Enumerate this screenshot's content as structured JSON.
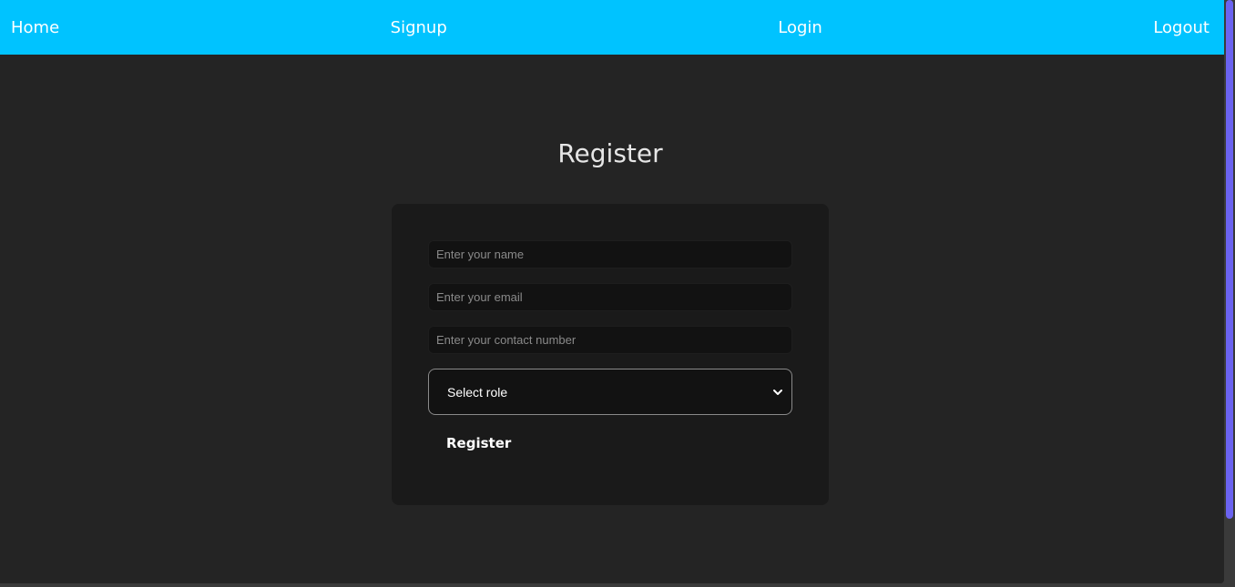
{
  "navbar": {
    "items": [
      {
        "label": "Home"
      },
      {
        "label": "Signup"
      },
      {
        "label": "Login"
      },
      {
        "label": "Logout"
      }
    ]
  },
  "page": {
    "title": "Register"
  },
  "form": {
    "name_placeholder": "Enter your name",
    "email_placeholder": "Enter your email",
    "contact_placeholder": "Enter your contact number",
    "role_selected": "Select role",
    "submit_label": "Register"
  },
  "colors": {
    "navbar_bg": "#00c3ff",
    "page_bg": "#242424",
    "card_bg": "#1a1a1a",
    "scrollbar_thumb": "#6b63f0"
  },
  "icons": {
    "select_arrow": "chevron-down-icon"
  }
}
